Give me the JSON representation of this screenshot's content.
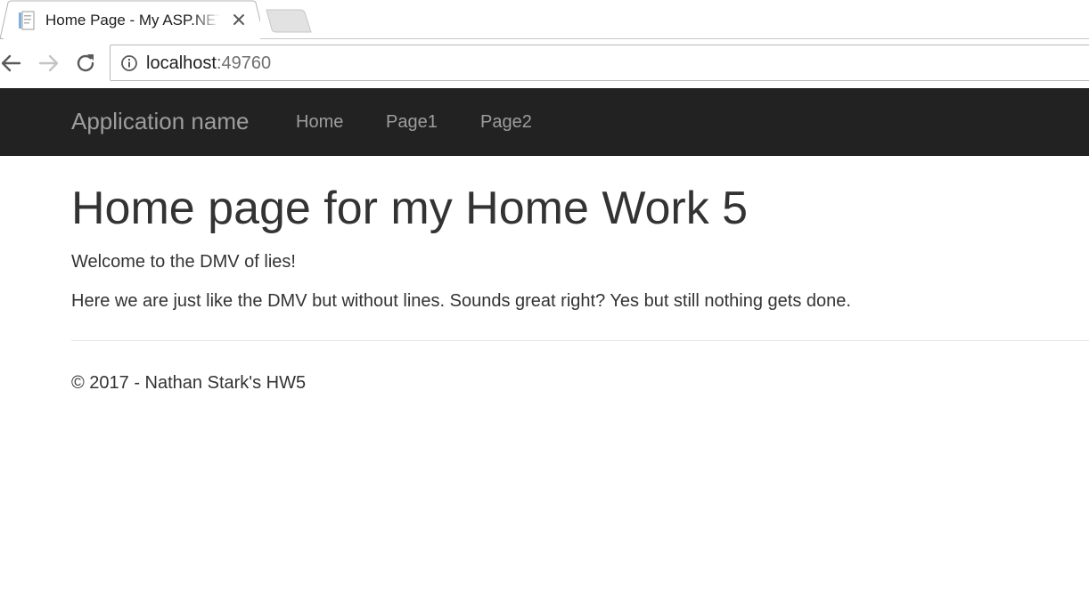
{
  "browser": {
    "tab_title": "Home Page - My ASP.NET Application",
    "url_host": "localhost",
    "url_port": ":49760"
  },
  "navbar": {
    "brand": "Application name",
    "links": [
      "Home",
      "Page1",
      "Page2"
    ]
  },
  "main": {
    "heading": "Home page for my Home Work 5",
    "paragraphs": [
      "Welcome to the DMV of lies!",
      "Here we are just like the DMV but without lines. Sounds great right? Yes but still nothing gets done."
    ]
  },
  "footer": {
    "text": "© 2017 - Nathan Stark's HW5"
  }
}
